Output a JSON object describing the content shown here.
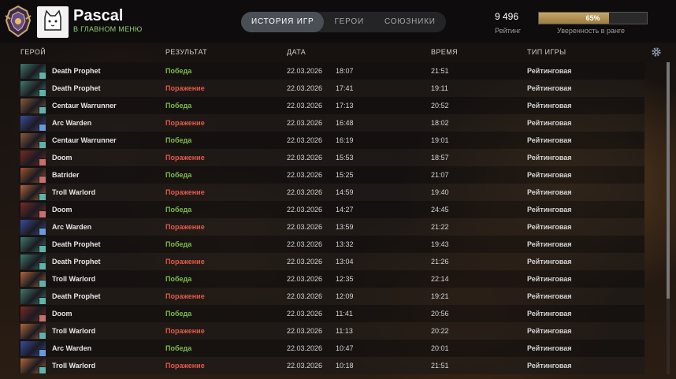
{
  "header": {
    "username": "Pascal",
    "status": "В ГЛАВНОМ МЕНЮ",
    "tabs": [
      {
        "label": "ИСТОРИЯ ИГР",
        "active": true
      },
      {
        "label": "ГЕРОИ",
        "active": false
      },
      {
        "label": "СОЮЗНИКИ",
        "active": false
      }
    ],
    "rating_value": "9 496",
    "rating_label": "Рейтинг",
    "confidence_percent": 65,
    "confidence_text": "65%",
    "confidence_label": "Уверенность в ранге"
  },
  "columns": {
    "hero": "ГЕРОЙ",
    "result": "РЕЗУЛЬТАТ",
    "date": "ДАТА",
    "duration": "ВРЕМЯ",
    "mode": "ТИП ИГРЫ"
  },
  "colors": {
    "win": "#7dbd4e",
    "loss": "#e35a4b",
    "status": "#8fd36f"
  },
  "matches": [
    {
      "hero": "Death Prophet",
      "result": "Победа",
      "win": true,
      "date": "22.03.2026",
      "time": "18:07",
      "duration": "21:51",
      "mode": "Рейтинговая",
      "icon_color": "#3f7a6b",
      "badge_color": "#5fb3a8"
    },
    {
      "hero": "Death Prophet",
      "result": "Поражение",
      "win": false,
      "date": "22.03.2026",
      "time": "17:41",
      "duration": "19:11",
      "mode": "Рейтинговая",
      "icon_color": "#3f7a6b",
      "badge_color": "#5fb3a8"
    },
    {
      "hero": "Centaur Warrunner",
      "result": "Победа",
      "win": true,
      "date": "22.03.2026",
      "time": "17:13",
      "duration": "20:52",
      "mode": "Рейтинговая",
      "icon_color": "#8a5a3a",
      "badge_color": "#5fb3a8"
    },
    {
      "hero": "Arc Warden",
      "result": "Поражение",
      "win": false,
      "date": "22.03.2026",
      "time": "16:48",
      "duration": "18:02",
      "mode": "Рейтинговая",
      "icon_color": "#3b4aa0",
      "badge_color": "#6a9ad8"
    },
    {
      "hero": "Centaur Warrunner",
      "result": "Победа",
      "win": true,
      "date": "22.03.2026",
      "time": "16:19",
      "duration": "19:01",
      "mode": "Рейтинговая",
      "icon_color": "#8a5a3a",
      "badge_color": "#5fb3a8"
    },
    {
      "hero": "Doom",
      "result": "Поражение",
      "win": false,
      "date": "22.03.2026",
      "time": "15:53",
      "duration": "18:57",
      "mode": "Рейтинговая",
      "icon_color": "#7a2a22",
      "badge_color": "#c86e6e"
    },
    {
      "hero": "Batrider",
      "result": "Победа",
      "win": true,
      "date": "22.03.2026",
      "time": "15:25",
      "duration": "21:07",
      "mode": "Рейтинговая",
      "icon_color": "#a0552a",
      "badge_color": "#c86e6e"
    },
    {
      "hero": "Troll Warlord",
      "result": "Поражение",
      "win": false,
      "date": "22.03.2026",
      "time": "14:59",
      "duration": "19:40",
      "mode": "Рейтинговая",
      "icon_color": "#b3653a",
      "badge_color": "#5fb3a8"
    },
    {
      "hero": "Doom",
      "result": "Победа",
      "win": true,
      "date": "22.03.2026",
      "time": "14:27",
      "duration": "24:45",
      "mode": "Рейтинговая",
      "icon_color": "#7a2a22",
      "badge_color": "#c86e6e"
    },
    {
      "hero": "Arc Warden",
      "result": "Поражение",
      "win": false,
      "date": "22.03.2026",
      "time": "13:59",
      "duration": "21:22",
      "mode": "Рейтинговая",
      "icon_color": "#3b4aa0",
      "badge_color": "#6a9ad8"
    },
    {
      "hero": "Death Prophet",
      "result": "Победа",
      "win": true,
      "date": "22.03.2026",
      "time": "13:32",
      "duration": "19:43",
      "mode": "Рейтинговая",
      "icon_color": "#3f7a6b",
      "badge_color": "#5fb3a8"
    },
    {
      "hero": "Death Prophet",
      "result": "Поражение",
      "win": false,
      "date": "22.03.2026",
      "time": "13:04",
      "duration": "21:26",
      "mode": "Рейтинговая",
      "icon_color": "#3f7a6b",
      "badge_color": "#5fb3a8"
    },
    {
      "hero": "Troll Warlord",
      "result": "Победа",
      "win": true,
      "date": "22.03.2026",
      "time": "12:35",
      "duration": "22:14",
      "mode": "Рейтинговая",
      "icon_color": "#b3653a",
      "badge_color": "#5fb3a8"
    },
    {
      "hero": "Death Prophet",
      "result": "Поражение",
      "win": false,
      "date": "22.03.2026",
      "time": "12:09",
      "duration": "19:21",
      "mode": "Рейтинговая",
      "icon_color": "#3f7a6b",
      "badge_color": "#5fb3a8"
    },
    {
      "hero": "Doom",
      "result": "Победа",
      "win": true,
      "date": "22.03.2026",
      "time": "11:41",
      "duration": "20:56",
      "mode": "Рейтинговая",
      "icon_color": "#7a2a22",
      "badge_color": "#c86e6e"
    },
    {
      "hero": "Troll Warlord",
      "result": "Поражение",
      "win": false,
      "date": "22.03.2026",
      "time": "11:13",
      "duration": "20:22",
      "mode": "Рейтинговая",
      "icon_color": "#b3653a",
      "badge_color": "#5fb3a8"
    },
    {
      "hero": "Arc Warden",
      "result": "Победа",
      "win": true,
      "date": "22.03.2026",
      "time": "10:47",
      "duration": "20:01",
      "mode": "Рейтинговая",
      "icon_color": "#3b4aa0",
      "badge_color": "#6a9ad8"
    },
    {
      "hero": "Troll Warlord",
      "result": "Поражение",
      "win": false,
      "date": "22.03.2026",
      "time": "10:18",
      "duration": "21:51",
      "mode": "Рейтинговая",
      "icon_color": "#b3653a",
      "badge_color": "#5fb3a8"
    }
  ]
}
